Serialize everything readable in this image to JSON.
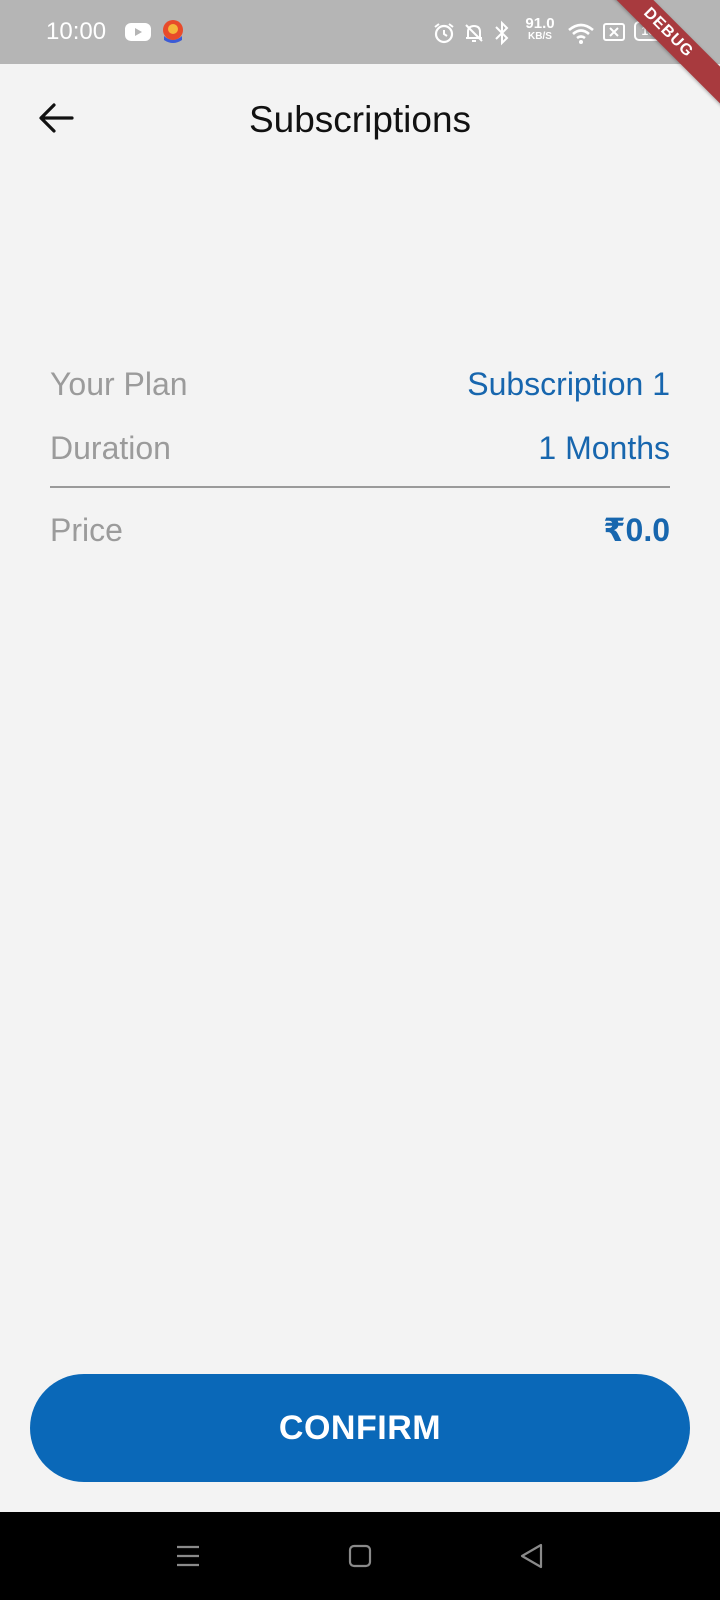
{
  "status_bar": {
    "time": "10:00",
    "net_speed_value": "91.0",
    "net_speed_unit": "KB/S",
    "battery_level": "100",
    "icons": [
      "youtube-icon",
      "app-notification-icon",
      "alarm-icon",
      "notifications-off-icon",
      "bluetooth-icon",
      "wifi-icon",
      "sim-no-signal-icon",
      "battery-icon"
    ]
  },
  "debug_banner": "DEBUG",
  "header": {
    "title": "Subscriptions",
    "back_icon": "arrow-back-icon"
  },
  "plan_details": {
    "plan_label": "Your Plan",
    "plan_value": "Subscription 1",
    "duration_label": "Duration",
    "duration_value": "1 Months",
    "price_label": "Price",
    "price_value": "₹0.0"
  },
  "confirm_label": "CONFIRM",
  "navigation_bar": {
    "icons": [
      "menu-icon",
      "home-icon",
      "back-icon"
    ]
  },
  "colors": {
    "accent": "#0a68b8",
    "value_text": "#1766ae",
    "label_text": "#9b9b9b",
    "status_bar_bg": "#b5b5b5",
    "debug_ribbon": "#a83a3e"
  }
}
